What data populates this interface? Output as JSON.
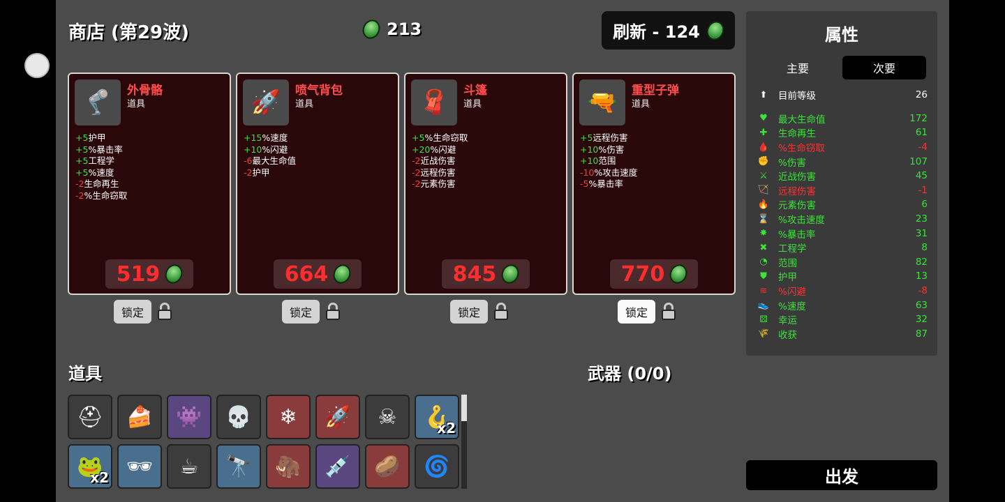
{
  "header": {
    "title": "商店 (第29波)",
    "gold": "213",
    "reroll_label": "刷新 - 124"
  },
  "cards": [
    {
      "name": "外骨骼",
      "type": "道具",
      "icon": "exoskeleton-icon",
      "glyph": "🦿",
      "stats": [
        {
          "v": "+5",
          "t": "护甲",
          "s": "pos"
        },
        {
          "v": "+5",
          "t": "%暴击率",
          "s": "pos"
        },
        {
          "v": "+5",
          "t": "工程学",
          "s": "pos"
        },
        {
          "v": "+5",
          "t": "%速度",
          "s": "pos"
        },
        {
          "v": "-2",
          "t": "生命再生",
          "s": "neg"
        },
        {
          "v": "-2",
          "t": "%生命窃取",
          "s": "neg"
        }
      ],
      "price": "519"
    },
    {
      "name": "喷气背包",
      "type": "道具",
      "icon": "jetpack-icon",
      "glyph": "🚀",
      "stats": [
        {
          "v": "+15",
          "t": "%速度",
          "s": "pos"
        },
        {
          "v": "+10",
          "t": "%闪避",
          "s": "pos"
        },
        {
          "v": "-6",
          "t": "最大生命值",
          "s": "neg"
        },
        {
          "v": "-2",
          "t": "护甲",
          "s": "neg"
        }
      ],
      "price": "664"
    },
    {
      "name": "斗篷",
      "type": "道具",
      "icon": "cape-icon",
      "glyph": "🧣",
      "stats": [
        {
          "v": "+5",
          "t": "%生命窃取",
          "s": "pos"
        },
        {
          "v": "+20",
          "t": "%闪避",
          "s": "pos"
        },
        {
          "v": "-2",
          "t": "近战伤害",
          "s": "neg"
        },
        {
          "v": "-2",
          "t": "远程伤害",
          "s": "neg"
        },
        {
          "v": "-2",
          "t": "元素伤害",
          "s": "neg"
        }
      ],
      "price": "845"
    },
    {
      "name": "重型子弹",
      "type": "道具",
      "icon": "heavy-bullet-icon",
      "glyph": "🔫",
      "stats": [
        {
          "v": "+5",
          "t": "远程伤害",
          "s": "pos"
        },
        {
          "v": "+10",
          "t": "%伤害",
          "s": "pos"
        },
        {
          "v": "+10",
          "t": "范围",
          "s": "pos"
        },
        {
          "v": "-10",
          "t": "%攻击速度",
          "s": "neg"
        },
        {
          "v": "-5",
          "t": "%暴击率",
          "s": "neg"
        }
      ],
      "price": "770"
    }
  ],
  "lock_label": "锁定",
  "sections": {
    "items": "道具",
    "weapons": "武器 (0/0)"
  },
  "inventory": [
    {
      "icon": "helmet-icon",
      "glyph": "⛑",
      "tier": "gray"
    },
    {
      "icon": "cake-icon",
      "glyph": "🍰",
      "tier": "gray"
    },
    {
      "icon": "alien-creature-icon",
      "glyph": "👾",
      "tier": "purple"
    },
    {
      "icon": "skull-mask-icon",
      "glyph": "💀",
      "tier": "gray"
    },
    {
      "icon": "snowflake-orb-icon",
      "glyph": "❄",
      "tier": "red"
    },
    {
      "icon": "jetpack-icon",
      "glyph": "🚀",
      "tier": "red"
    },
    {
      "icon": "animal-skull-icon",
      "glyph": "☠",
      "tier": "gray"
    },
    {
      "icon": "claw-icon",
      "glyph": "🪝",
      "tier": "blue",
      "qty": "x2"
    },
    {
      "icon": "frog-icon",
      "glyph": "🐸",
      "tier": "blue",
      "qty": "x2"
    },
    {
      "icon": "glasses-icon",
      "glyph": "🕶",
      "tier": "blue"
    },
    {
      "icon": "coffee-icon",
      "glyph": "☕",
      "tier": "gray"
    },
    {
      "icon": "telescope-icon",
      "glyph": "🔭",
      "tier": "blue"
    },
    {
      "icon": "mammoth-icon",
      "glyph": "🦣",
      "tier": "red"
    },
    {
      "icon": "syringe-icon",
      "glyph": "💉",
      "tier": "purple"
    },
    {
      "icon": "potato-icon",
      "glyph": "🥔",
      "tier": "red"
    },
    {
      "icon": "swirl-icon",
      "glyph": "🌀",
      "tier": "gray"
    }
  ],
  "stats_panel": {
    "title": "属性",
    "tabs": [
      "主要",
      "次要"
    ],
    "active_tab": 1,
    "rows": [
      {
        "label": "目前等级",
        "value": "26",
        "color": "white",
        "icon": "level-icon",
        "glyph": "⬆"
      },
      {
        "label": "最大生命值",
        "value": "172",
        "color": "green",
        "icon": "heart-icon",
        "glyph": "♥"
      },
      {
        "label": "生命再生",
        "value": "61",
        "color": "green",
        "icon": "regen-icon",
        "glyph": "✚"
      },
      {
        "label": "%生命窃取",
        "value": "-4",
        "color": "red",
        "icon": "lifesteal-icon",
        "glyph": "🩸"
      },
      {
        "label": "%伤害",
        "value": "107",
        "color": "green",
        "icon": "damage-icon",
        "glyph": "✊"
      },
      {
        "label": "近战伤害",
        "value": "45",
        "color": "green",
        "icon": "melee-icon",
        "glyph": "⚔"
      },
      {
        "label": "远程伤害",
        "value": "-1",
        "color": "red",
        "icon": "ranged-icon",
        "glyph": "🏹"
      },
      {
        "label": "元素伤害",
        "value": "6",
        "color": "green",
        "icon": "elemental-icon",
        "glyph": "🔥"
      },
      {
        "label": "%攻击速度",
        "value": "23",
        "color": "green",
        "icon": "hourglass-icon",
        "glyph": "⌛"
      },
      {
        "label": "%暴击率",
        "value": "31",
        "color": "green",
        "icon": "crit-icon",
        "glyph": "✸"
      },
      {
        "label": "工程学",
        "value": "8",
        "color": "green",
        "icon": "engineering-icon",
        "glyph": "✖"
      },
      {
        "label": "范围",
        "value": "82",
        "color": "green",
        "icon": "range-icon",
        "glyph": "◔"
      },
      {
        "label": "护甲",
        "value": "13",
        "color": "green",
        "icon": "armor-icon",
        "glyph": "⛊"
      },
      {
        "label": "%闪避",
        "value": "-8",
        "color": "red",
        "icon": "dodge-icon",
        "glyph": "≋"
      },
      {
        "label": "%速度",
        "value": "63",
        "color": "green",
        "icon": "speed-icon",
        "glyph": "👟"
      },
      {
        "label": "幸运",
        "value": "32",
        "color": "green",
        "icon": "dice-icon",
        "glyph": "⚄"
      },
      {
        "label": "收获",
        "value": "87",
        "color": "green",
        "icon": "harvest-icon",
        "glyph": "🌾"
      }
    ]
  },
  "go_label": "出发"
}
